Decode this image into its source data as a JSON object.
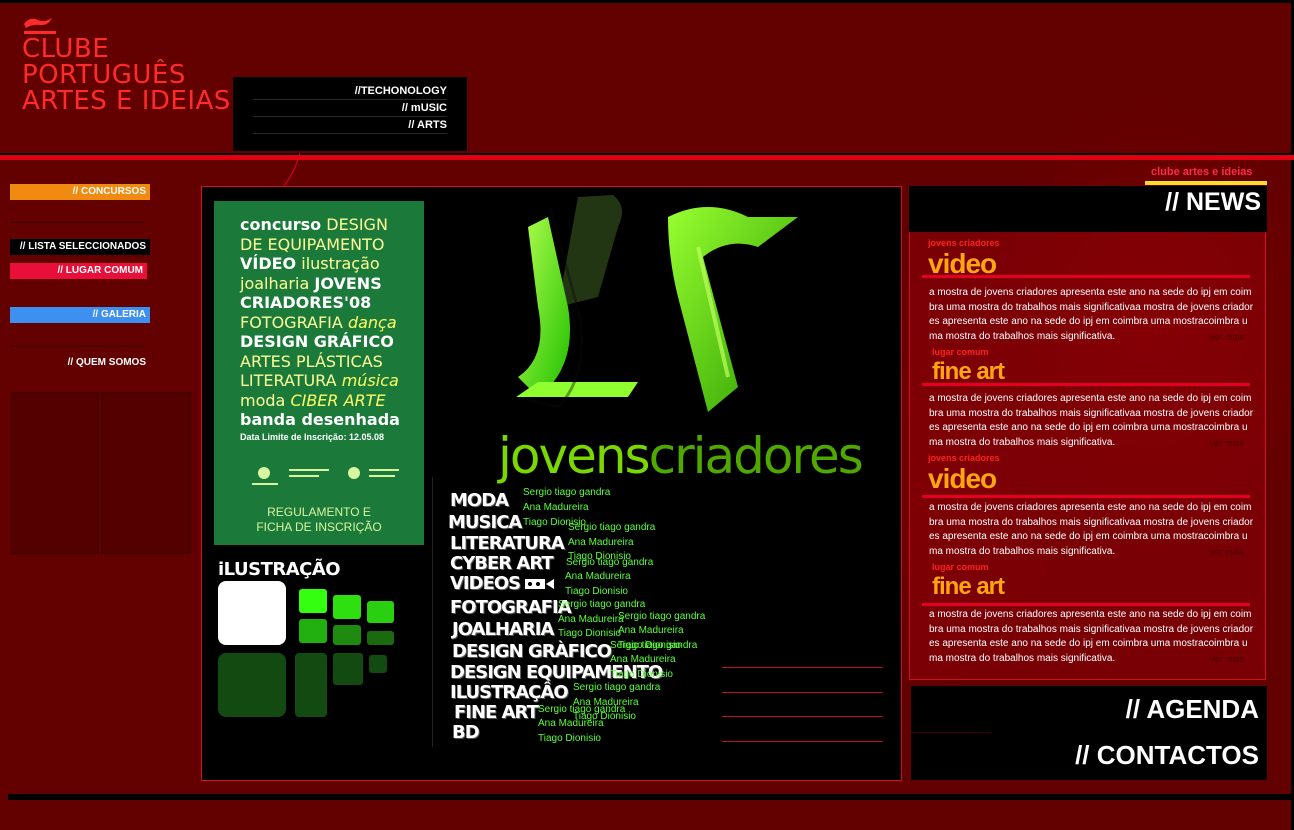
{
  "brand": {
    "line1": "CLUBE",
    "line2": "PORTUGUÊS",
    "line3": "ARTES E IDEIAS",
    "tagline": "clube artes e ideias"
  },
  "topnav": [
    "//TECHONOLOGY",
    "// mUSIC",
    "// ARTS"
  ],
  "leftnav": {
    "concursos": "// CONCURSOS",
    "lista": "// LISTA SELECCIONADOS",
    "lugar": "// LUGAR COMUM",
    "galeria": "// GALERIA",
    "quem": "// QUEM SOMOS"
  },
  "poster": {
    "lines": [
      [
        "concurso",
        "DESIGN"
      ],
      [
        "",
        "DE EQUIPAMENTO"
      ],
      [
        "VÍDEO",
        "ilustração"
      ],
      [
        "joalharia",
        "JOVENS"
      ],
      [
        "CRIADORES'08",
        ""
      ],
      [
        "FOTOGRAFIA",
        "dança"
      ],
      [
        "DESIGN GRÁFICO",
        ""
      ],
      [
        "",
        "ARTES PLÁSTICAS"
      ],
      [
        "LITERATURA",
        "música"
      ],
      [
        "moda",
        "CIBER ARTE"
      ],
      [
        "banda desenhada",
        ""
      ]
    ],
    "deadline": "Data Limite de Inscrição: 12.05.08",
    "footer1": "REGULAMENTO E",
    "footer2": "FICHA DE INSCRIÇÃO"
  },
  "ilustracao_label": "iLUSTRAÇÃO",
  "jovens": {
    "part1": "jovens",
    "part2": "criadores"
  },
  "categories": [
    "MODA",
    "MUSICA",
    "LITERATURA",
    "CYBER ART",
    "VIDEOS",
    "FOTOGRAFIA",
    "JOALHARIA",
    "DESIGN GRÀFICO",
    "DESIGN EQUIPAMENTO",
    "ILUSTRAÇÂO",
    "FINE ART",
    "BD"
  ],
  "names": {
    "a": "Sergio tiago gandra",
    "b": "Ana Madureira",
    "c": "Tiago Dionisio"
  },
  "news": {
    "header": "// NEWS",
    "items": [
      {
        "kicker": "jovens criadores",
        "title": "video",
        "body": "a mostra de jovens criadores apresenta este ano na sede do ipj em coimbra uma mostra do trabalhos mais significativaa mostra de jovens criadores apresenta este ano na sede do ipj em coimbra uma mostracoimbra uma mostra do trabalhos mais significativa.",
        "more": "ver mais"
      },
      {
        "kicker": "lugar comum",
        "title": "fine art",
        "body": "a mostra de jovens criadores apresenta este ano na sede do ipj em coimbra uma mostra do trabalhos mais significativaa mostra de jovens criadores apresenta este ano na sede do ipj em coimbra uma mostracoimbra uma mostra do trabalhos mais significativa.",
        "more": "ver mais"
      },
      {
        "kicker": "jovens criadores",
        "title": "video",
        "body": "a mostra de jovens criadores apresenta este ano na sede do ipj em coimbra uma mostra do trabalhos mais significativaa mostra de jovens criadores apresenta este ano na sede do ipj em coimbra uma mostracoimbra uma mostra do trabalhos mais significativa.",
        "more": "ver mais"
      },
      {
        "kicker": "lugar comum",
        "title": "fine art",
        "body": "a mostra de jovens criadores apresenta este ano na sede do ipj em coimbra uma mostra do trabalhos mais significativaa mostra de jovens criadores apresenta este ano na sede do ipj em coimbra uma mostracoimbra uma mostra do trabalhos mais significativa.",
        "more": "ver mais"
      }
    ]
  },
  "agenda": "// AGENDA",
  "contactos": "// CONTACTOS",
  "colors": {
    "background": "#630000",
    "accent_red": "#e00010",
    "concursos": "#f08a10",
    "lugar_comum": "#e8103a",
    "galeria": "#3d8ff0",
    "news_title": "#ffa510",
    "green": "#5bff3a"
  }
}
